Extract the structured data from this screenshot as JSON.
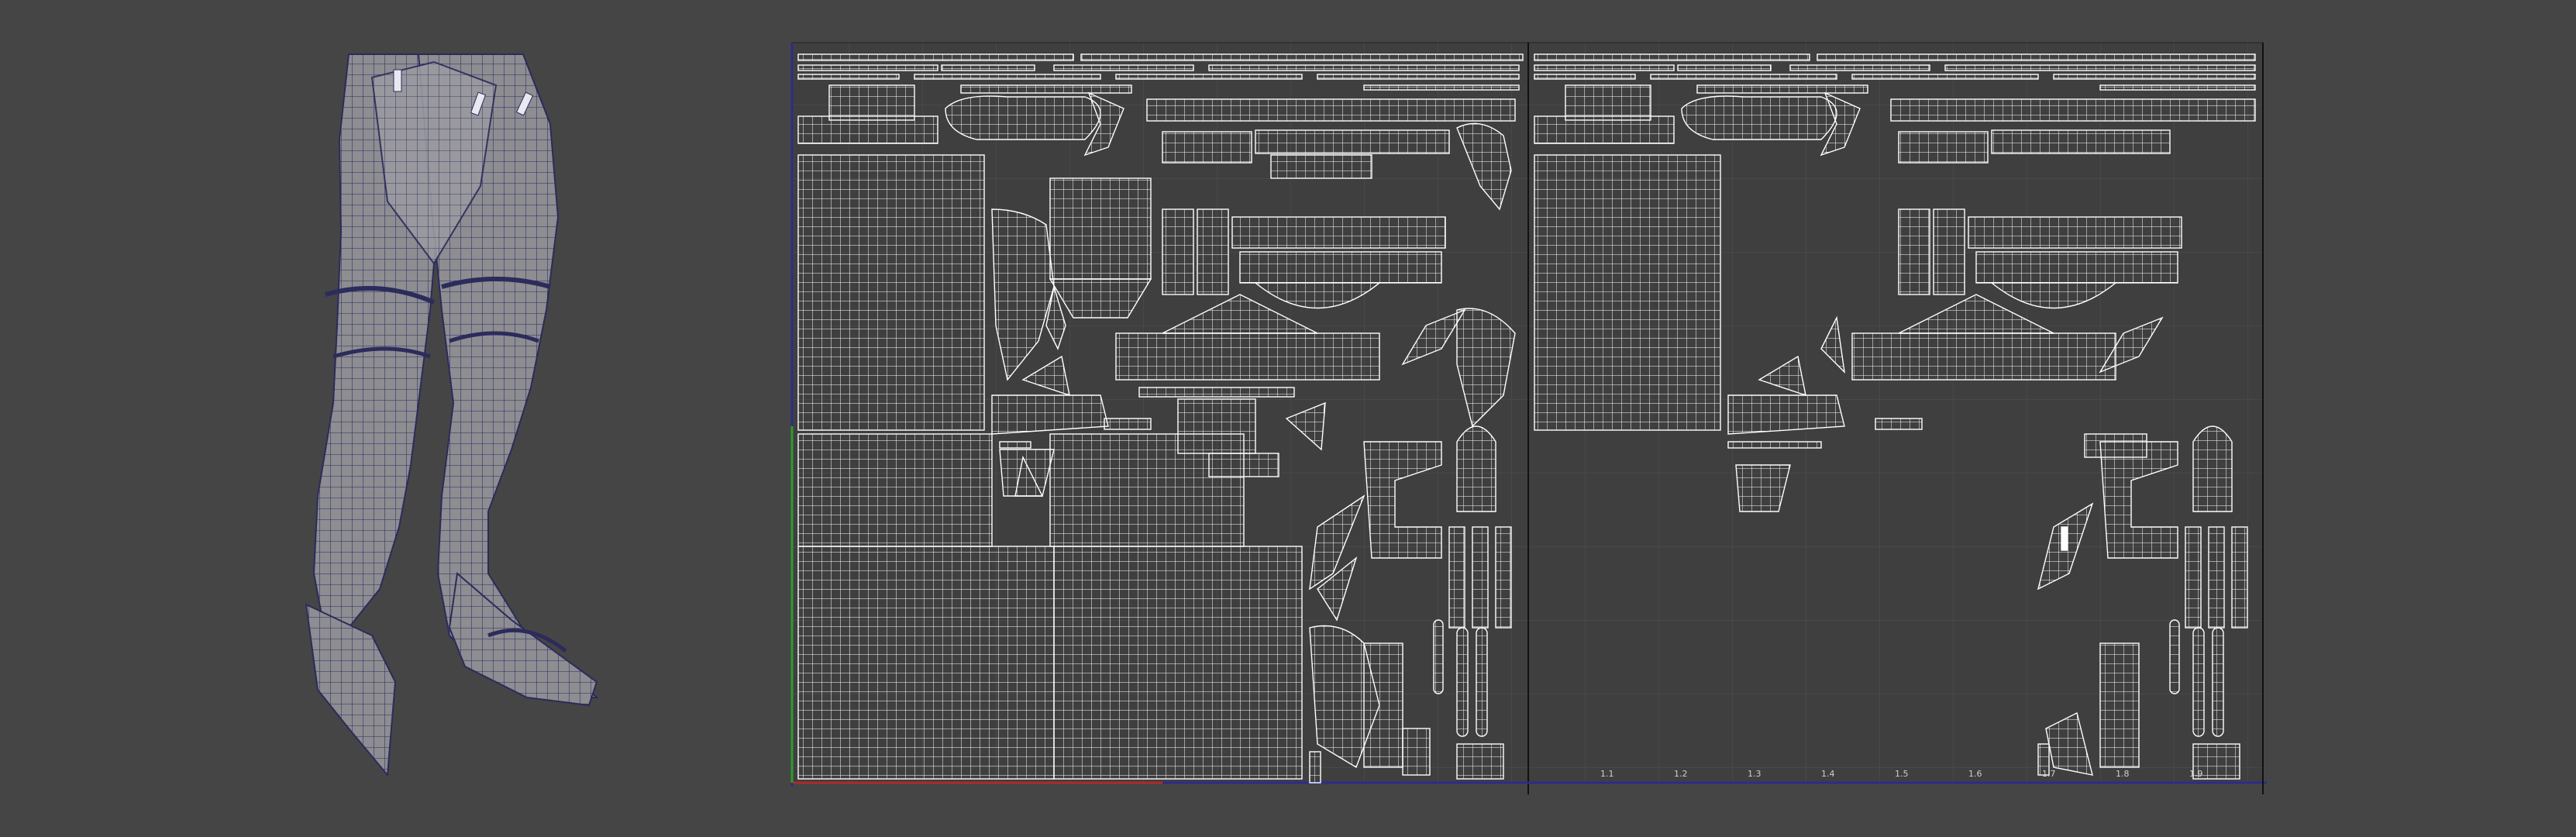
{
  "app": {
    "viewport_3d": "pant-leg-mesh-wireframe",
    "uv_editor": "uv-layout-two-tiles"
  },
  "uv_editor": {
    "axis_ticks_right": [
      "1.1",
      "1.2",
      "1.3",
      "1.4",
      "1.5",
      "1.6",
      "1.7",
      "1.8",
      "1.9"
    ],
    "colors": {
      "background": "#454545",
      "uv_background": "#3f3f3f",
      "uv_lines": "#ffffff",
      "grid": "#555555",
      "axis_u": "#2c2c8a",
      "axis_v": "#2f9a2f",
      "axis_u_highlight": "#b02a2a",
      "mesh_fill": "#8d8d92",
      "mesh_wire": "#2b2b5c"
    }
  }
}
